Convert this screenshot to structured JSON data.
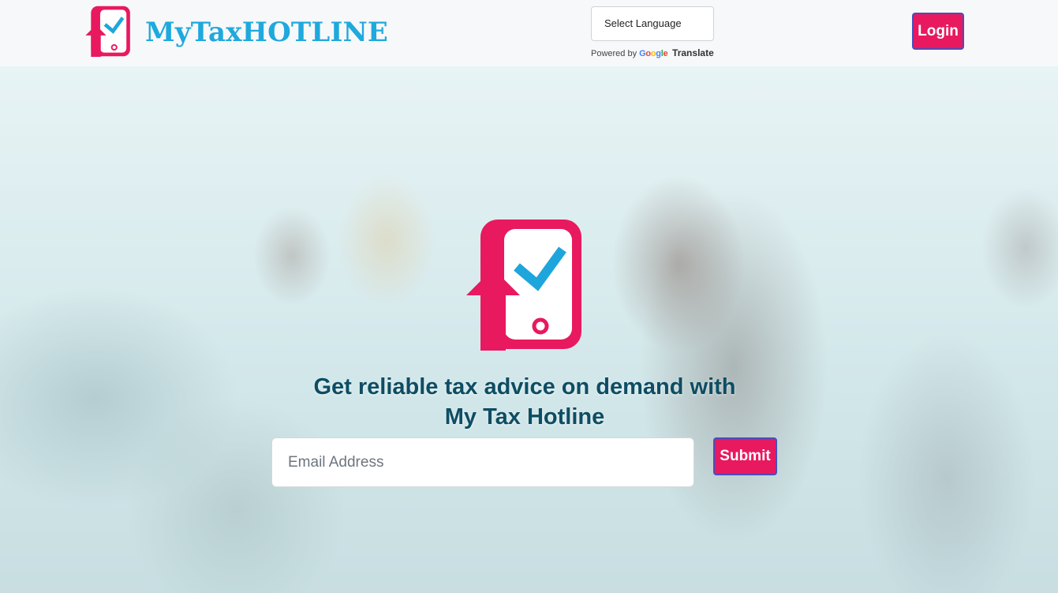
{
  "header": {
    "brand": "MyTaxHOTLINE",
    "logo_icon": "phone-check-upload-icon",
    "language_select": {
      "selected": "Select Language"
    },
    "powered_by": {
      "prefix": "Powered by",
      "google": "Google",
      "translate": "Translate"
    },
    "login_label": "Login"
  },
  "hero": {
    "logo_icon": "phone-check-upload-icon",
    "headline_line1": "Get reliable tax advice on demand with",
    "headline_line2": "My Tax Hotline",
    "email_placeholder": "Email Address",
    "submit_label": "Submit"
  },
  "colors": {
    "accent_pink": "#e8195f",
    "brand_blue": "#1fa9dd",
    "check_blue": "#1ea6dc",
    "headline": "#0e4d63",
    "button_border": "#4a4dbd"
  }
}
